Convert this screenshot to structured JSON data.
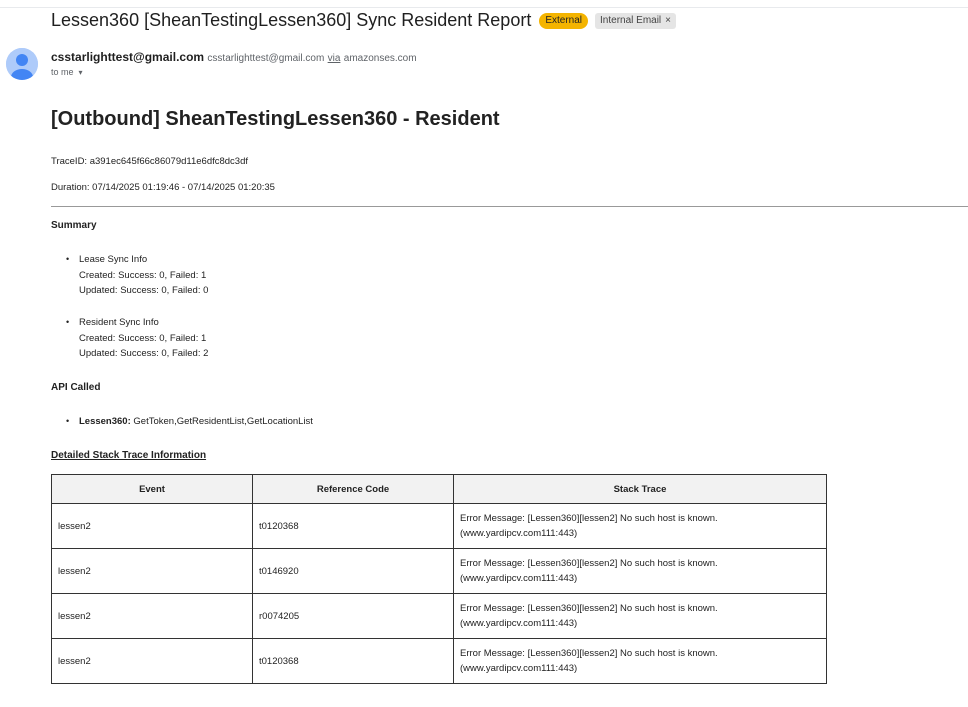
{
  "email": {
    "subject": "Lessen360 [SheanTestingLessen360] Sync Resident Report",
    "badges": {
      "external": "External",
      "label": "Internal Email",
      "label_close": "×"
    },
    "sender": {
      "name": "csstarlighttest@gmail.com",
      "email": "csstarlighttest@gmail.com",
      "via": "via",
      "domain": "amazonses.com"
    },
    "recipient": "to me",
    "caret": "▾"
  },
  "report": {
    "title": "[Outbound] SheanTestingLessen360 - Resident",
    "trace_id": "TraceID: a391ec645f66c86079d11e6dfc8dc3df",
    "duration": "Duration: 07/14/2025 01:19:46 - 07/14/2025 01:20:35",
    "summary_heading": "Summary",
    "summary": [
      {
        "bullet": "•",
        "title": "Lease Sync Info",
        "created": "Created: Success: 0, Failed: 1",
        "updated": "Updated: Success: 0, Failed: 0"
      },
      {
        "bullet": "•",
        "title": "Resident Sync Info",
        "created": "Created: Success: 0, Failed: 1",
        "updated": "Updated: Success: 0, Failed: 2"
      }
    ],
    "api_heading": "API Called",
    "api": {
      "bullet": "•",
      "name": "Lessen360:",
      "calls": " GetToken,GetResidentList,GetLocationList"
    },
    "trace_heading": "Detailed Stack Trace Information",
    "table": {
      "headers": [
        "Event",
        "Reference Code",
        "Stack Trace"
      ],
      "rows": [
        [
          "lessen2",
          "t0120368",
          "Error Message: [Lessen360][lessen2] No such host is known.",
          "(www.yardipcv.com111:443)"
        ],
        [
          "lessen2",
          "t0146920",
          "Error Message: [Lessen360][lessen2] No such host is known.",
          "(www.yardipcv.com111:443)"
        ],
        [
          "lessen2",
          "r0074205",
          "Error Message: [Lessen360][lessen2] No such host is known.",
          "(www.yardipcv.com111:443)"
        ],
        [
          "lessen2",
          "t0120368",
          "Error Message: [Lessen360][lessen2] No such host is known.",
          "(www.yardipcv.com111:443)"
        ]
      ]
    }
  },
  "colors": {
    "external_badge": "#f4b400",
    "label_badge": "#e5e5e5",
    "avatar_bg": "#aecbfa",
    "avatar_fg": "#4285f4"
  }
}
